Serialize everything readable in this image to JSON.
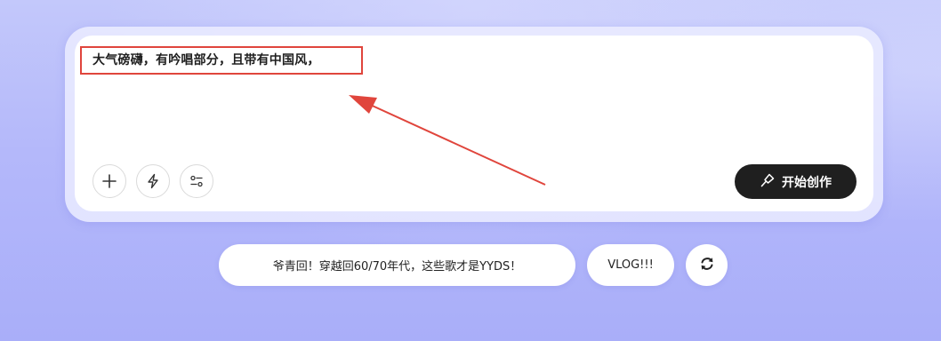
{
  "prompt": {
    "text": "大气磅礴，有吟唱部分，且带有中国风，"
  },
  "toolbar": {
    "add_icon": "plus-icon",
    "lightning_icon": "lightning-icon",
    "settings_icon": "sliders-icon"
  },
  "start_button": {
    "label": "开始创作",
    "icon": "pen-nib-icon"
  },
  "suggestions": [
    {
      "label": "爷青回！穿越回60/70年代，这些歌才是YYDS！"
    },
    {
      "label": "VLOG!!!"
    }
  ],
  "refresh_icon": "refresh-icon",
  "colors": {
    "background": "#b4b8fa",
    "annotation": "#e0453c",
    "start_button_bg": "#1f1f1f"
  }
}
